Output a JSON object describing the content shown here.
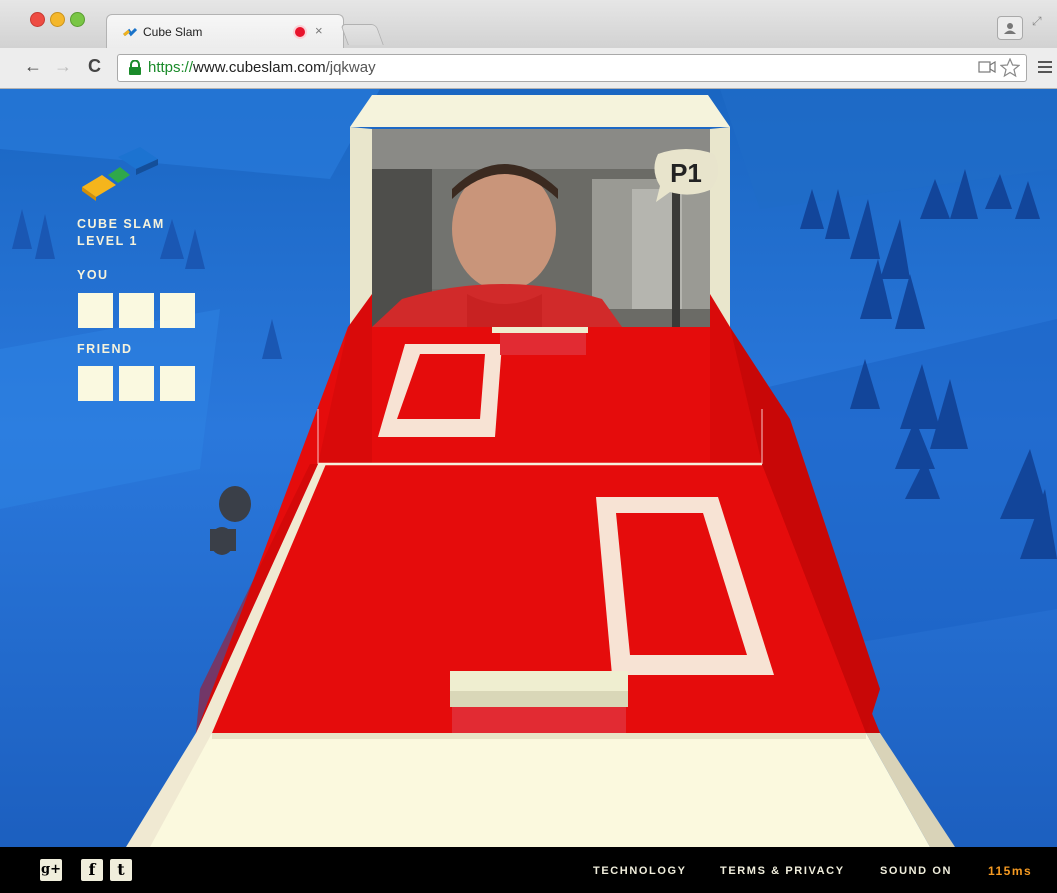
{
  "browser": {
    "tab": {
      "title": "Cube Slam",
      "favicon": "cubeslam-favicon",
      "recording": true
    },
    "url": {
      "scheme": "https://",
      "host": "www.cubeslam.com",
      "path": "/jqkway"
    },
    "icons": [
      "back-arrow",
      "forward-arrow",
      "reload",
      "lock",
      "camera",
      "star",
      "menu",
      "profile",
      "fullscreen"
    ]
  },
  "hud": {
    "game_title": "CUBE SLAM",
    "level": "LEVEL 1",
    "you_label": "YOU",
    "friend_label": "FRIEND",
    "you_score_boxes": 3,
    "friend_score_boxes": 3
  },
  "opponent": {
    "badge": "P1"
  },
  "footer": {
    "social": [
      "g+",
      "f",
      "t"
    ],
    "links": {
      "technology": "TECHNOLOGY",
      "terms": "TERMS & PRIVACY",
      "sound": "SOUND ON"
    },
    "latency": "115ms"
  },
  "colors": {
    "arena_red": "#e50c0c",
    "arena_wall": "#f7f4dc",
    "sky_blue": "#1f6fd2",
    "latency_orange": "#f59a22"
  }
}
